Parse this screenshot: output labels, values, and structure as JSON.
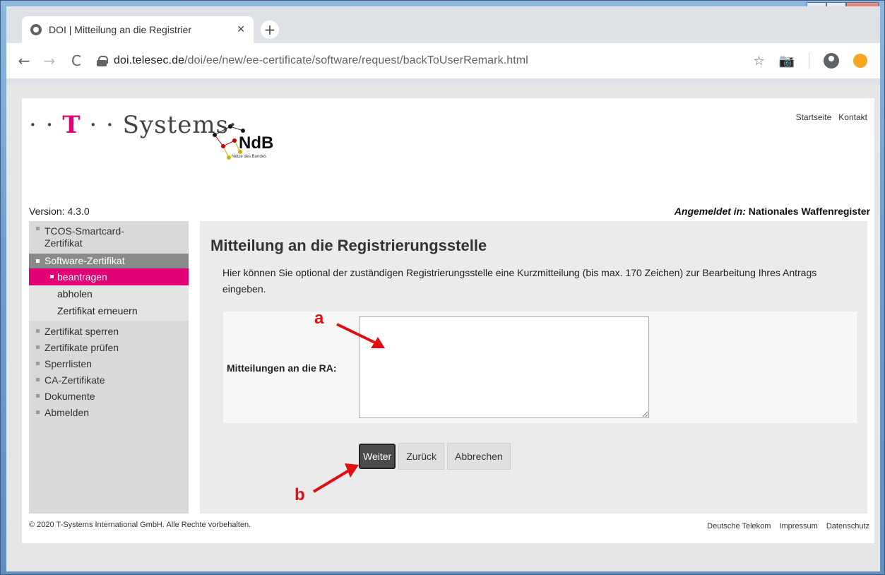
{
  "browser": {
    "tab_title": "DOI | Mitteilung an die Registrier",
    "tab_close": "✕",
    "new_tab": "+",
    "url_host": "doi.telesec.de",
    "url_path": "/doi/ee/new/ee-certificate/software/request/backToUserRemark.html",
    "back": "←",
    "forward": "→",
    "reload": "C",
    "star": "☆",
    "camera": "📷",
    "window_min": "‒",
    "window_max": "▢",
    "window_close": "X"
  },
  "header": {
    "logo_prefix": "· · ",
    "logo_t": "T",
    "logo_suffix": " · · Systems·",
    "ndb_title": "NdB",
    "ndb_sub": "Netze des Bundes",
    "top_links": [
      "Startseite",
      "Kontakt"
    ],
    "version": "Version: 4.3.0",
    "logged_in_label": "Angemeldet in:",
    "logged_in_value": "Nationales Waffenregister"
  },
  "sidebar": {
    "items": [
      {
        "label": "TCOS-Smartcard-Zertifikat"
      },
      {
        "label": "Software-Zertifikat"
      },
      {
        "label": "Zertifikat sperren"
      },
      {
        "label": "Zertifikate prüfen"
      },
      {
        "label": "Sperrlisten"
      },
      {
        "label": "CA-Zertifikate"
      },
      {
        "label": "Dokumente"
      },
      {
        "label": "Abmelden"
      }
    ],
    "subitems": [
      {
        "label": "beantragen"
      },
      {
        "label": "abholen"
      },
      {
        "label": "Zertifikat erneuern"
      }
    ]
  },
  "main": {
    "title": "Mitteilung an die Registrierungsstelle",
    "intro": "Hier können Sie optional der zuständigen Registrierungsstelle eine Kurzmitteilung (bis max. 170 Zeichen) zur Bearbeitung Ihres Antrags eingeben.",
    "field_label": "Mitteilungen an die RA:",
    "field_value": "",
    "buttons": {
      "next": "Weiter",
      "back": "Zurück",
      "cancel": "Abbrechen"
    }
  },
  "annotations": {
    "a": "a",
    "b": "b"
  },
  "footer": {
    "copyright": "© 2020 T-Systems International GmbH. Alle Rechte vorbehalten.",
    "links": [
      "Deutsche Telekom",
      "Impressum",
      "Datenschutz"
    ]
  }
}
